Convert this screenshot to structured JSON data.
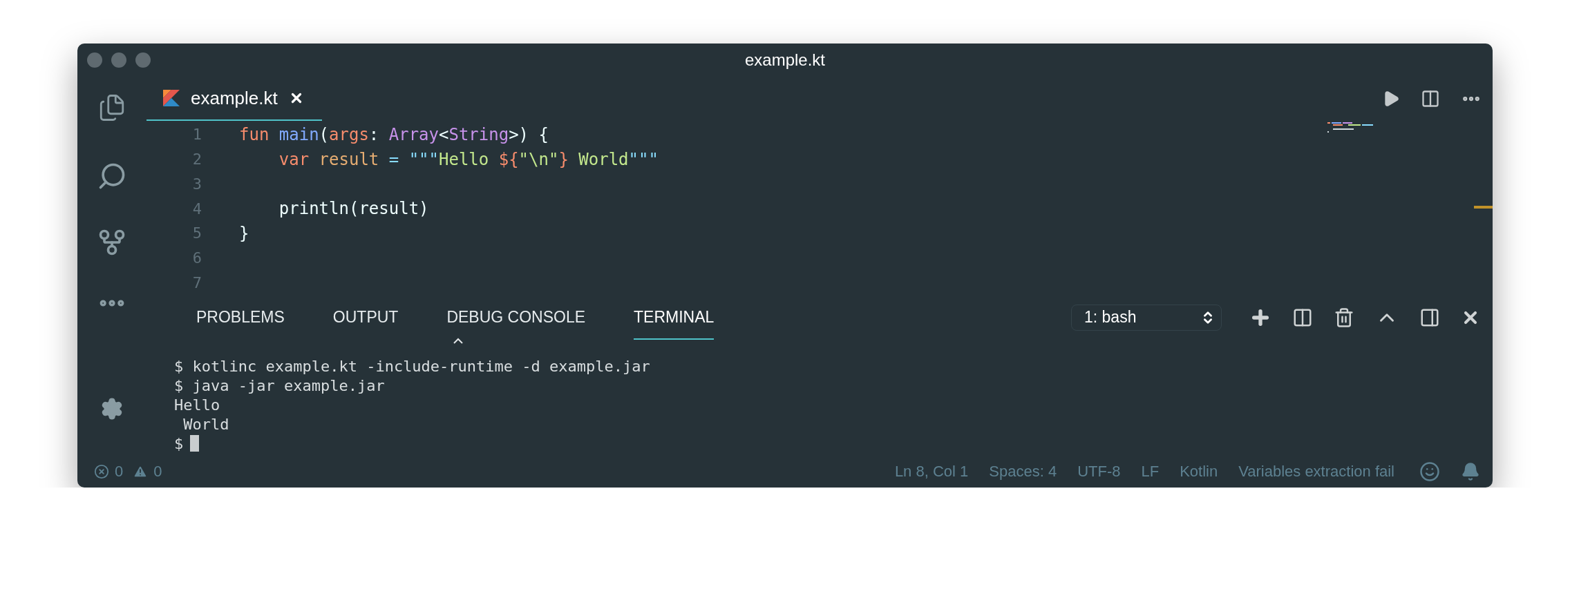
{
  "window": {
    "title": "example.kt"
  },
  "editor_tabs": [
    {
      "label": "example.kt",
      "selected": true
    }
  ],
  "code_lines": [
    {
      "number": "1",
      "tokens": [
        {
          "text": "fun ",
          "kind": "keyword"
        },
        {
          "text": "main",
          "kind": "function"
        },
        {
          "text": "(",
          "kind": "plain"
        },
        {
          "text": "args",
          "kind": "param"
        },
        {
          "text": ": ",
          "kind": "plain"
        },
        {
          "text": "Array",
          "kind": "type"
        },
        {
          "text": "<",
          "kind": "plain"
        },
        {
          "text": "String",
          "kind": "type"
        },
        {
          "text": ">) {",
          "kind": "plain"
        }
      ]
    },
    {
      "number": "2",
      "tokens": [
        {
          "text": "    var ",
          "kind": "keyword"
        },
        {
          "text": "result ",
          "kind": "variable"
        },
        {
          "text": "= \"\"\"",
          "kind": "operator"
        },
        {
          "text": "Hello ",
          "kind": "string"
        },
        {
          "text": "${",
          "kind": "interp"
        },
        {
          "text": "\"\\n\"",
          "kind": "string"
        },
        {
          "text": "}",
          "kind": "interp"
        },
        {
          "text": " World",
          "kind": "string"
        },
        {
          "text": "\"\"\"",
          "kind": "operator"
        }
      ]
    },
    {
      "number": "3"
    },
    {
      "number": "4",
      "tokens": [
        {
          "text": "    println(result)",
          "kind": "plain"
        }
      ]
    },
    {
      "number": "5",
      "tokens": [
        {
          "text": "}",
          "kind": "plain"
        }
      ]
    },
    {
      "number": "6"
    },
    {
      "number": "7"
    }
  ],
  "panel": {
    "tabs": [
      {
        "label": "PROBLEMS",
        "selected": false
      },
      {
        "label": "OUTPUT",
        "selected": false
      },
      {
        "label": "DEBUG CONSOLE",
        "selected": false
      },
      {
        "label": "TERMINAL",
        "selected": true
      }
    ],
    "terminal_select": {
      "value": "1: bash"
    },
    "terminal_lines": [
      {
        "text": "$ kotlinc example.kt -include-runtime -d example.jar",
        "cursor": false
      },
      {
        "text": "$ java -jar example.jar",
        "cursor": false
      },
      {
        "text": "Hello",
        "cursor": false
      },
      {
        "text": " World",
        "cursor": false
      },
      {
        "text": "$",
        "cursor": true
      }
    ]
  },
  "status_bar": {
    "errors": "0",
    "warnings": "0",
    "items": [
      "Ln 8, Col 1",
      "Spaces: 4",
      "UTF-8",
      "LF",
      "Kotlin",
      "Variables extraction fail"
    ]
  }
}
